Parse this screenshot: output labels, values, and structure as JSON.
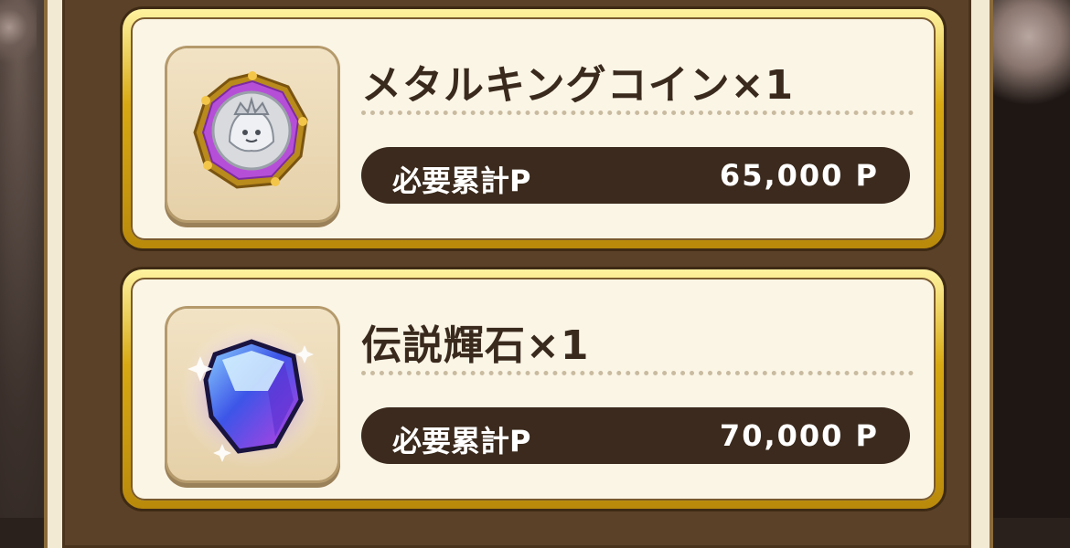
{
  "rewards": [
    {
      "name": "メタルキングコイン×1",
      "requirement_label": "必要累計P",
      "requirement_value": "65,000 P",
      "icon": "metal-king-coin-icon"
    },
    {
      "name": "伝説輝石×1",
      "requirement_label": "必要累計P",
      "requirement_value": "70,000 P",
      "icon": "legendary-gem-icon"
    }
  ],
  "colors": {
    "card_gold": "#d7a812",
    "card_cream": "#fbf5e6",
    "pill_dark": "#3b2a1d",
    "title_text": "#3a2a1e",
    "panel_brown": "#5b4127"
  }
}
